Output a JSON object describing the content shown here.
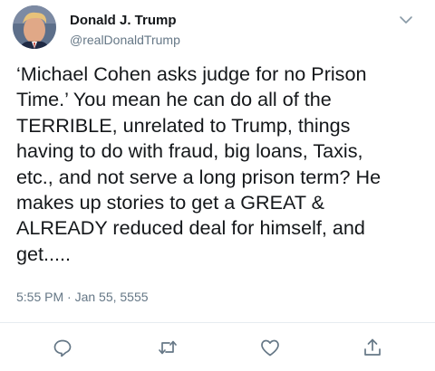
{
  "author": {
    "name": "Donald J. Trump",
    "handle": "@realDonaldTrump",
    "avatar_icon": "profile-photo"
  },
  "menu": {
    "icon": "chevron-down-icon"
  },
  "tweet": {
    "text": "‘Michael Cohen asks judge for no Prison\nTime.’ You mean he can do all of the\nTERRIBLE, unrelated to Trump, things\nhaving to do with fraud, big loans, Taxis,\netc., and not serve a long prison term? He\nmakes up stories to get a GREAT &\nALREADY reduced deal for himself, and\nget.....",
    "timestamp": "5:55 PM · Jan 55, 5555"
  },
  "actions": [
    {
      "name": "reply",
      "icon": "reply-icon"
    },
    {
      "name": "retweet",
      "icon": "retweet-icon"
    },
    {
      "name": "like",
      "icon": "heart-icon"
    },
    {
      "name": "share",
      "icon": "share-icon"
    }
  ],
  "colors": {
    "text": "#14171a",
    "secondary": "#657786",
    "icon": "#657786",
    "divider": "#e6ecf0"
  }
}
